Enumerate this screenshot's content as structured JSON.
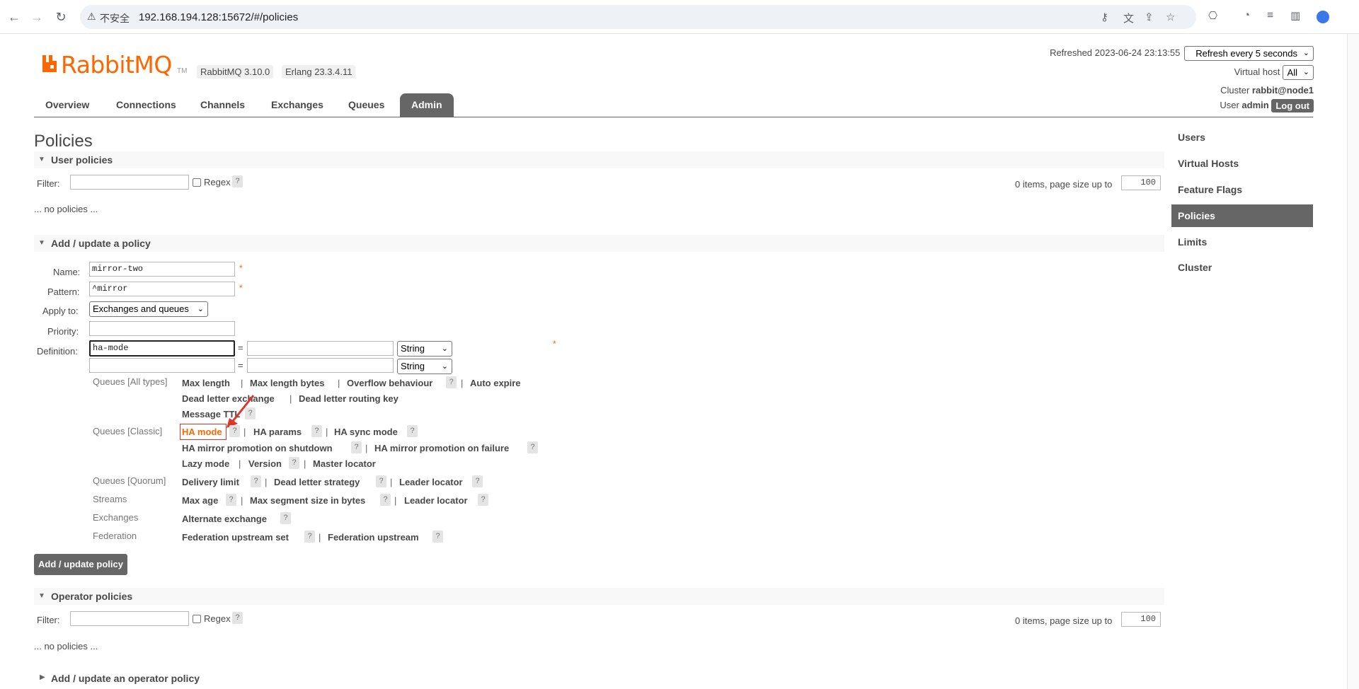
{
  "browser": {
    "insecure_label": "不安全",
    "url": "192.168.194.128:15672/#/policies"
  },
  "header": {
    "logo_text": "RabbitMQ",
    "logo_tm": "TM",
    "version": "RabbitMQ 3.10.0",
    "erlang": "Erlang 23.3.4.11",
    "refreshed_label": "Refreshed 2023-06-24 23:13:55",
    "refresh_option": "Refresh every 5 seconds",
    "vhost_label": "Virtual host",
    "vhost_value": "All",
    "cluster_label": "Cluster",
    "cluster_value": "rabbit@node1",
    "user_label": "User",
    "user_value": "admin",
    "logout_label": "Log out"
  },
  "tabs": [
    {
      "label": "Overview"
    },
    {
      "label": "Connections"
    },
    {
      "label": "Channels"
    },
    {
      "label": "Exchanges"
    },
    {
      "label": "Queues"
    },
    {
      "label": "Admin"
    }
  ],
  "page_title": "Policies",
  "user_policies": {
    "title": "User policies",
    "filter_label": "Filter:",
    "regex_label": "Regex",
    "help": "?",
    "items_label": "0 items, page size up to",
    "page_size": "100",
    "empty": "... no policies ..."
  },
  "add_policy": {
    "title": "Add / update a policy",
    "name_label": "Name:",
    "name_value": "mirror-two",
    "pattern_label": "Pattern:",
    "pattern_value": "^mirror",
    "apply_label": "Apply to:",
    "apply_value": "Exchanges and queues",
    "priority_label": "Priority:",
    "definition_label": "Definition:",
    "def_key_1": "ha-mode",
    "eq": "=",
    "type_value": "String",
    "required": "*",
    "categories": {
      "queues_all": "Queues [All types]",
      "queues_classic": "Queues [Classic]",
      "queues_quorum": "Queues [Quorum]",
      "streams": "Streams",
      "exchanges": "Exchanges",
      "federation": "Federation"
    },
    "keys": {
      "max_length": "Max length",
      "max_length_bytes": "Max length bytes",
      "overflow": "Overflow behaviour",
      "auto_expire": "Auto expire",
      "dlx": "Dead letter exchange",
      "dlrk": "Dead letter routing key",
      "message_ttl": "Message TTL",
      "ha_mode": "HA mode",
      "ha_params": "HA params",
      "ha_sync": "HA sync mode",
      "ha_promo_shutdown": "HA mirror promotion on shutdown",
      "ha_promo_failure": "HA mirror promotion on failure",
      "lazy_mode": "Lazy mode",
      "version": "Version",
      "master_locator": "Master locator",
      "delivery_limit": "Delivery limit",
      "dl_strategy": "Dead letter strategy",
      "leader_locator": "Leader locator",
      "max_age": "Max age",
      "max_segment": "Max segment size in bytes",
      "leader_locator_2": "Leader locator",
      "alt_exchange": "Alternate exchange",
      "fed_upstream_set": "Federation upstream set",
      "fed_upstream": "Federation upstream"
    },
    "pipe": "|",
    "submit_label": "Add / update policy"
  },
  "operator_policies": {
    "title": "Operator policies",
    "filter_label": "Filter:",
    "regex_label": "Regex",
    "help": "?",
    "items_label": "0 items, page size up to",
    "page_size": "100",
    "empty": "... no policies ..."
  },
  "operator_add_title": "Add / update an operator policy",
  "sidebar": {
    "items": [
      {
        "label": "Users"
      },
      {
        "label": "Virtual Hosts"
      },
      {
        "label": "Feature Flags"
      },
      {
        "label": "Policies"
      },
      {
        "label": "Limits"
      },
      {
        "label": "Cluster"
      }
    ],
    "active_index": 3
  },
  "colors": {
    "brand": "#ff6600",
    "tab_active": "#666666",
    "annotation_red": "#e0342a"
  }
}
